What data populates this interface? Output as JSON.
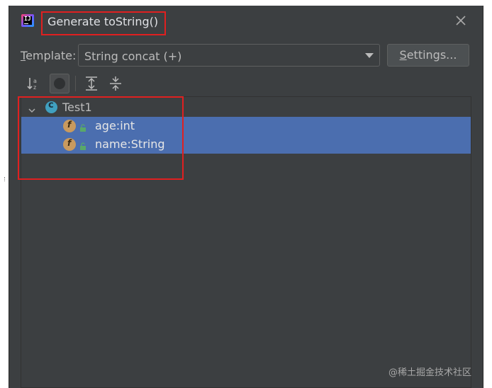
{
  "dialog": {
    "title": "Generate toString()",
    "accent_border": "#e02020"
  },
  "template": {
    "label_first": "T",
    "label_rest": "emplate:",
    "selected": "String concat (+)"
  },
  "settings_button": {
    "label_first": "S",
    "label_rest": "ettings..."
  },
  "toolbar": {
    "icons": [
      "sort-alphabetical-icon",
      "toggle-icon",
      "expand-all-icon",
      "collapse-all-icon"
    ]
  },
  "tree": {
    "root": {
      "label": "Test1",
      "icon": "class-icon"
    },
    "fields": [
      {
        "label": "age:int",
        "icon": "field-icon",
        "selected": true
      },
      {
        "label": "name:String",
        "icon": "field-icon",
        "selected": true
      }
    ],
    "selection_color": "#4b6eaf"
  },
  "watermark": "@稀土掘金技术社区"
}
